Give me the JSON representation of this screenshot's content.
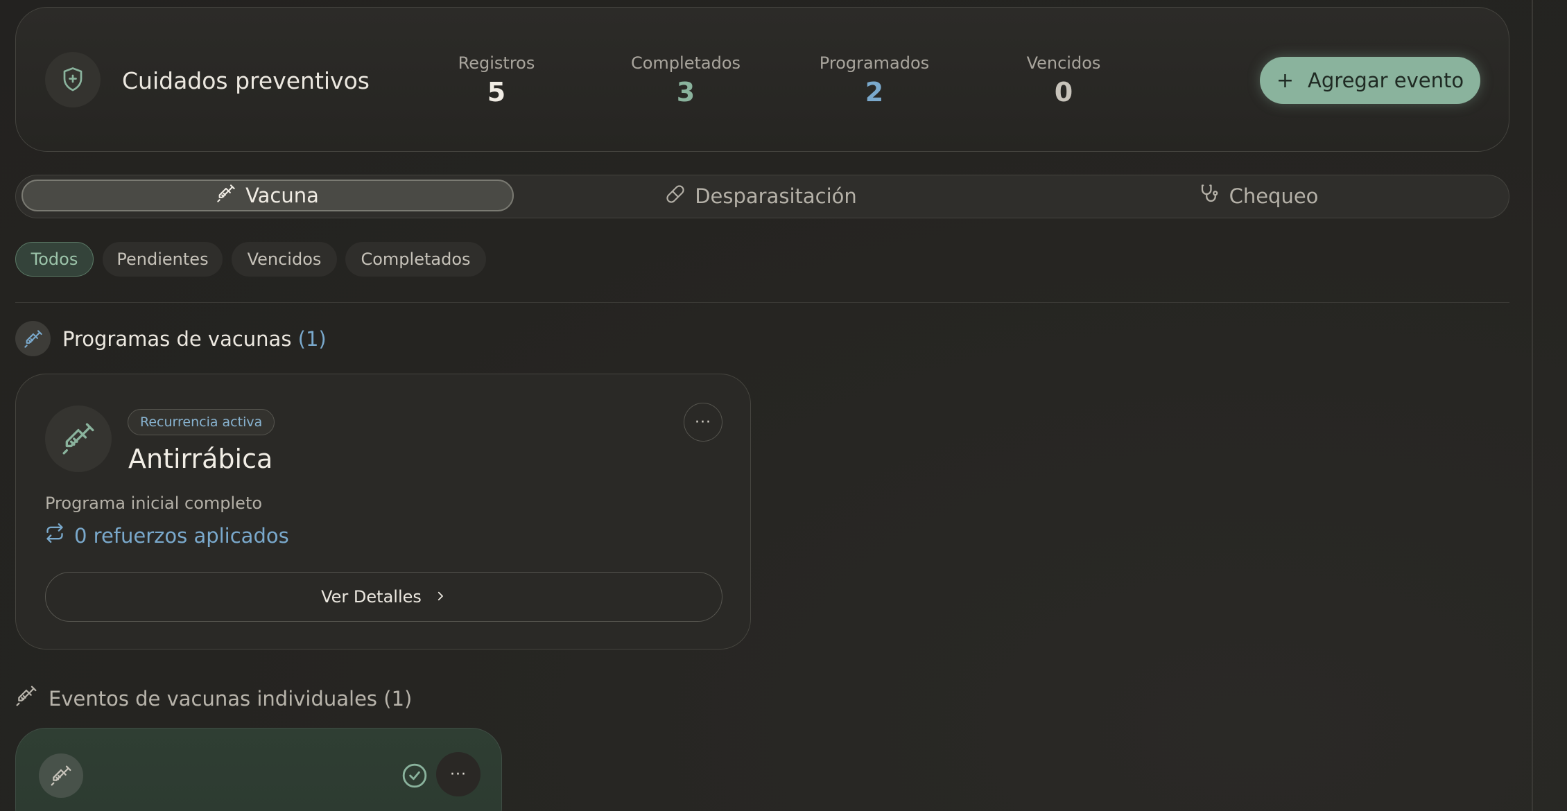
{
  "header": {
    "title": "Cuidados preventivos",
    "icon": "shield-plus-icon",
    "stats": [
      {
        "label": "Registros",
        "value": "5",
        "color": "#f0ece4"
      },
      {
        "label": "Completados",
        "value": "3",
        "color": "#8ab39d"
      },
      {
        "label": "Programados",
        "value": "2",
        "color": "#7aa9cc"
      },
      {
        "label": "Vencidos",
        "value": "0",
        "color": "#c8c4bb"
      }
    ],
    "add_button": {
      "label": "Agregar evento",
      "icon": "plus-icon"
    }
  },
  "type_tabs": [
    {
      "label": "Vacuna",
      "icon": "syringe-icon",
      "active": true
    },
    {
      "label": "Desparasitación",
      "icon": "pill-icon",
      "active": false
    },
    {
      "label": "Chequeo",
      "icon": "stethoscope-icon",
      "active": false
    }
  ],
  "filters": [
    {
      "label": "Todos",
      "active": true
    },
    {
      "label": "Pendientes",
      "active": false
    },
    {
      "label": "Vencidos",
      "active": false
    },
    {
      "label": "Completados",
      "active": false
    }
  ],
  "programs_section": {
    "title": "Programas de vacunas",
    "count": "(1)"
  },
  "program_card": {
    "badge": "Recurrencia activa",
    "title": "Antirrábica",
    "subtitle": "Programa inicial completo",
    "boosters": "0 refuerzos aplicados",
    "details_button": "Ver Detalles",
    "menu": "···"
  },
  "individual_section": {
    "title": "Eventos de vacunas individuales (1)"
  },
  "event_card": {
    "menu": "···"
  },
  "colors": {
    "accent_green": "#8ab39d",
    "accent_blue": "#7aa9cc",
    "background": "#262522"
  }
}
